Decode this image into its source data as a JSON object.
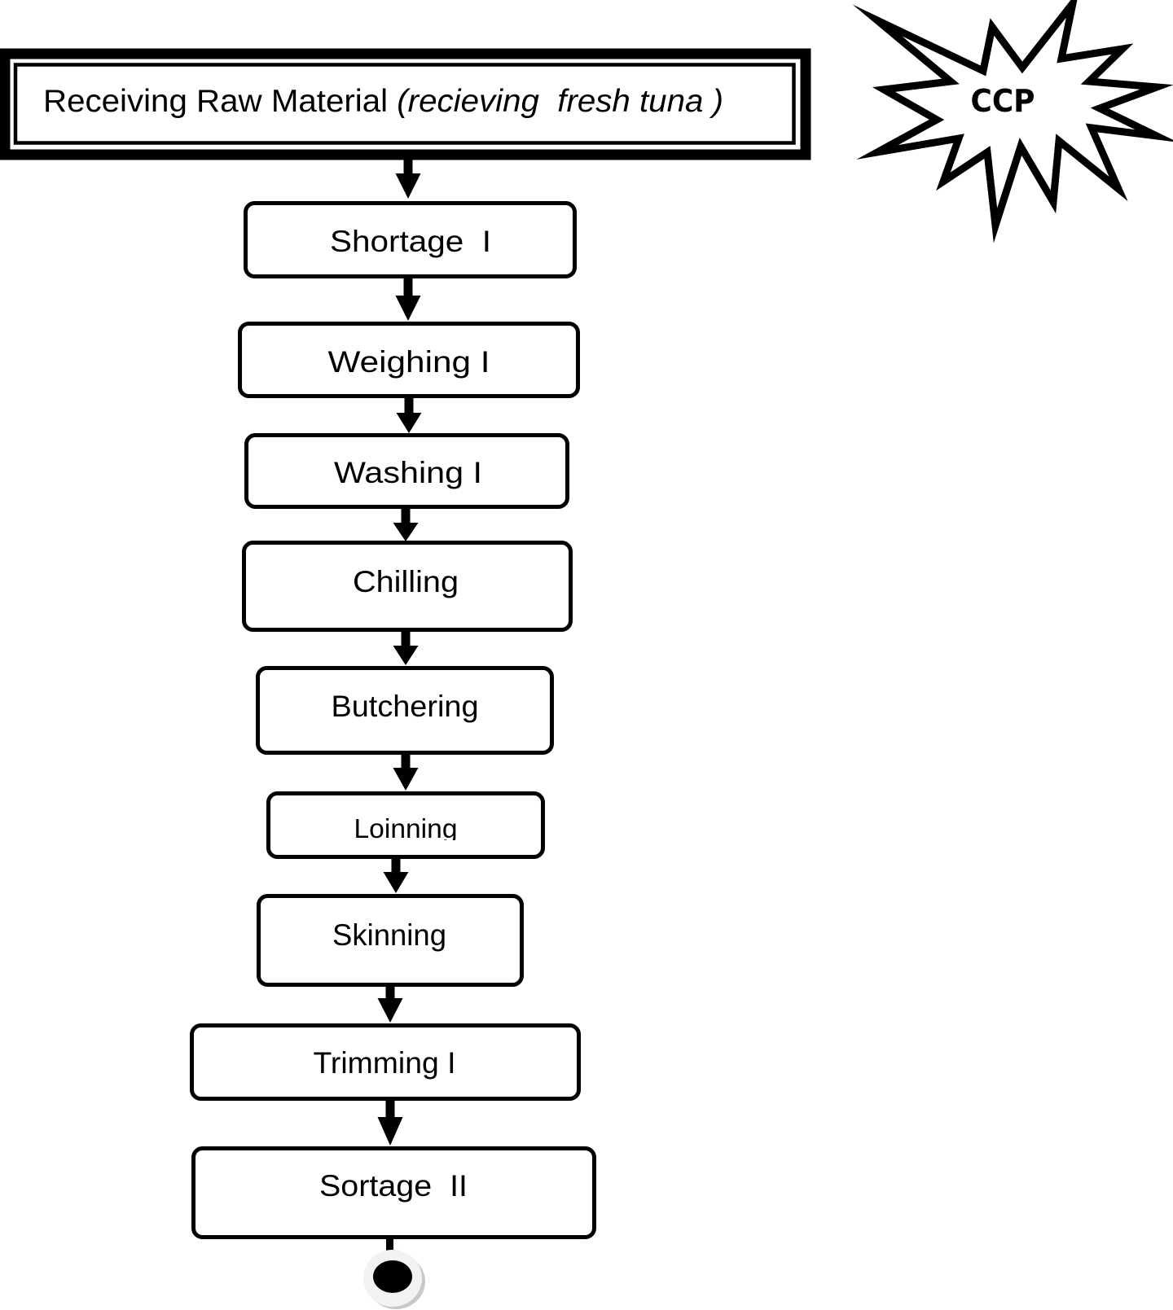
{
  "diagram": {
    "type": "process-flowchart",
    "start": {
      "label": "Receiving Raw Material",
      "note": "(recieving  fresh tuna )"
    },
    "ccp_badge": {
      "label": "CCP",
      "shape": "explosion-starburst"
    },
    "steps": [
      {
        "label": "Shortage  I"
      },
      {
        "label": "Weighing I"
      },
      {
        "label": "Washing I"
      },
      {
        "label": "Chilling"
      },
      {
        "label": "Butchering"
      },
      {
        "label": "Loinning"
      },
      {
        "label": "Skinning"
      },
      {
        "label": "Trimming I"
      },
      {
        "label": "Sortage  II"
      }
    ],
    "end_marker": "end-node",
    "colors": {
      "stroke": "#000000",
      "fill": "#ffffff",
      "end_ring": "#f2f2f2",
      "end_shadow": "#c8c8c8"
    }
  }
}
